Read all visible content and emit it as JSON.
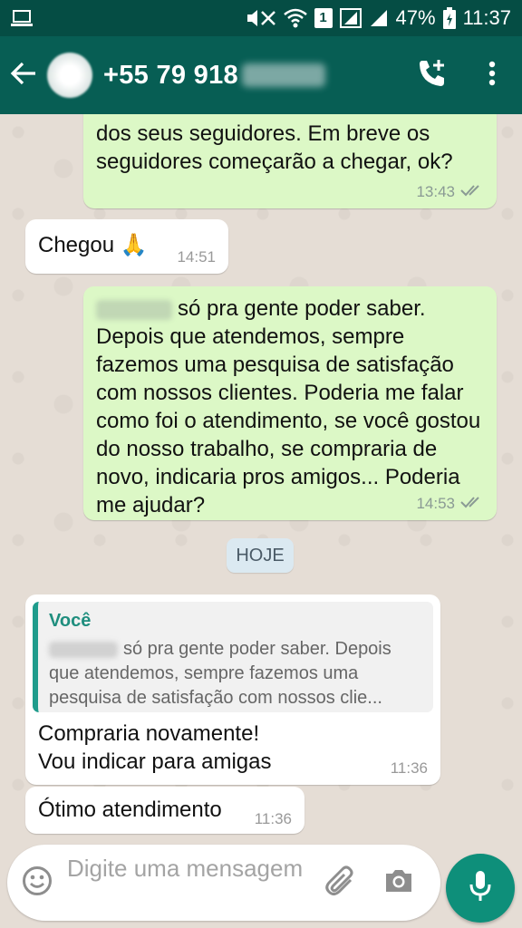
{
  "status_bar": {
    "sim_badge": "1",
    "battery": "47%",
    "time": "11:37"
  },
  "header": {
    "contact_name": "+55 79 918"
  },
  "messages": [
    {
      "direction": "out",
      "text_line1": "dos seus seguidores. Em breve os",
      "text_line2": "seguidores começarão a chegar, ok?",
      "time": "13:43"
    },
    {
      "direction": "in",
      "text": "Chegou 🙏",
      "time": "14:51"
    },
    {
      "direction": "out",
      "text_first": "só pra gente poder saber.",
      "text_rest": "Depois que atendemos, sempre fazemos uma pesquisa de satisfação com nossos clientes. Poderia me falar como foi o atendimento, se você gostou do nosso trabalho, se compraria de novo, indicaria pros amigos... Poderia me ajudar?",
      "time": "14:53"
    },
    {
      "direction": "in",
      "quote_author": "Você",
      "quote_first": "só pra gente poder saber. Depois",
      "quote_rest": "que atendemos, sempre fazemos uma pesquisa de satisfação com nossos clie...",
      "text_line1": "Compraria novamente!",
      "text_line2": "Vou indicar para amigas",
      "time": "11:36"
    },
    {
      "direction": "in",
      "text": "Ótimo atendimento",
      "time": "11:36"
    }
  ],
  "date_separator": "HOJE",
  "composer": {
    "placeholder": "Digite uma mensagem"
  },
  "colors": {
    "app_bar": "#075e54",
    "status_bar": "#054d44",
    "outgoing_bubble": "#dcf8c6",
    "incoming_bubble": "#ffffff",
    "accent": "#0e8f7a"
  },
  "icons": [
    "laptop-icon",
    "mute-icon",
    "wifi-icon",
    "signal-icon",
    "battery-icon",
    "back-arrow-icon",
    "add-call-icon",
    "more-vert-icon",
    "double-check-icon",
    "emoji-icon",
    "attach-icon",
    "camera-icon",
    "mic-icon"
  ]
}
